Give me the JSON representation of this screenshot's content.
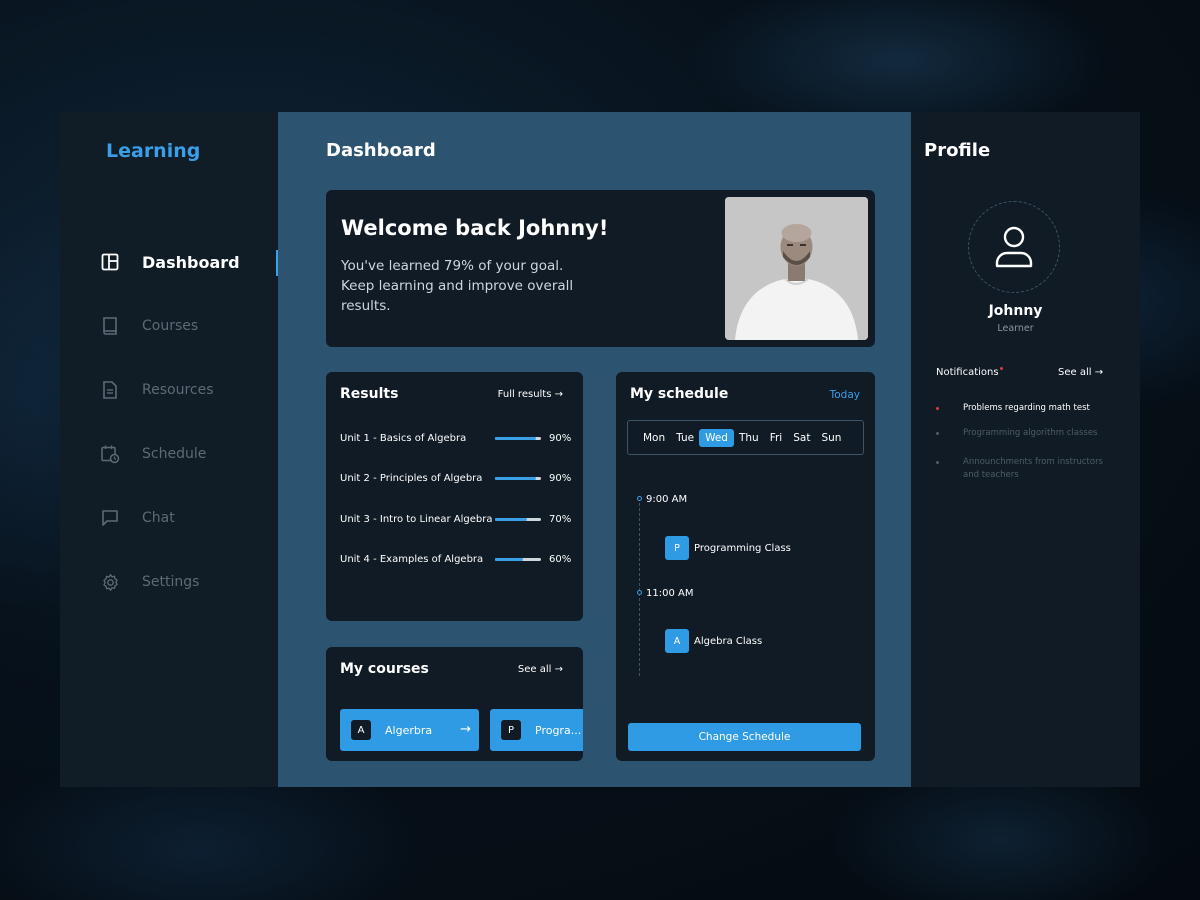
{
  "brand": "Learning",
  "nav": [
    {
      "label": "Dashboard",
      "icon": "layout-icon",
      "active": true
    },
    {
      "label": "Courses",
      "icon": "book-icon"
    },
    {
      "label": "Resources",
      "icon": "file-icon"
    },
    {
      "label": "Schedule",
      "icon": "calendar-icon"
    },
    {
      "label": "Chat",
      "icon": "chat-icon"
    },
    {
      "label": "Settings",
      "icon": "gear-icon"
    }
  ],
  "main": {
    "title": "Dashboard",
    "welcome": {
      "heading": "Welcome back Johnny!",
      "message": "You've learned 79% of your goal. Keep learning and improve overall results."
    },
    "results": {
      "title": "Results",
      "link": "Full results →",
      "rows": [
        {
          "label": "Unit 1 - Basics of Algebra",
          "percent": "90%",
          "progress": 0.9
        },
        {
          "label": "Unit 2 - Principles of Algebra",
          "percent": "90%",
          "progress": 0.9
        },
        {
          "label": "Unit 3 - Intro to Linear Algebra",
          "percent": "70%",
          "progress": 0.7
        },
        {
          "label": "Unit 4 - Examples of Algebra",
          "percent": "60%",
          "progress": 0.6
        }
      ]
    },
    "courses": {
      "title": "My courses",
      "link": "See all →",
      "items": [
        {
          "badge": "A",
          "name": "Algerbra",
          "arrow": "→"
        },
        {
          "badge": "P",
          "name": "Progra..."
        }
      ]
    },
    "schedule": {
      "title": "My schedule",
      "today": "Today",
      "days": [
        "Mon",
        "Tue",
        "Wed",
        "Thu",
        "Fri",
        "Sat",
        "Sun"
      ],
      "active_day": "Wed",
      "slots": [
        {
          "time": "9:00 AM",
          "badge": "P",
          "name": "Programming Class"
        },
        {
          "time": "11:00 AM",
          "badge": "A",
          "name": "Algebra Class"
        }
      ],
      "button": "Change Schedule"
    }
  },
  "profile": {
    "title": "Profile",
    "name": "Johnny",
    "role": "Learner",
    "notifications_title": "Notifications",
    "see_all": "See all →",
    "notifications": [
      {
        "text": "Problems regarding math test",
        "unread": true
      },
      {
        "text": "Programming algorithm classes",
        "unread": false
      },
      {
        "text": "Announchments from instructors and teachers",
        "unread": false
      }
    ]
  },
  "colors": {
    "accent": "#2f9be4",
    "sidebar": "#101c26",
    "main": "#2c5470",
    "card": "#101b25",
    "alert": "#e23b3b"
  }
}
